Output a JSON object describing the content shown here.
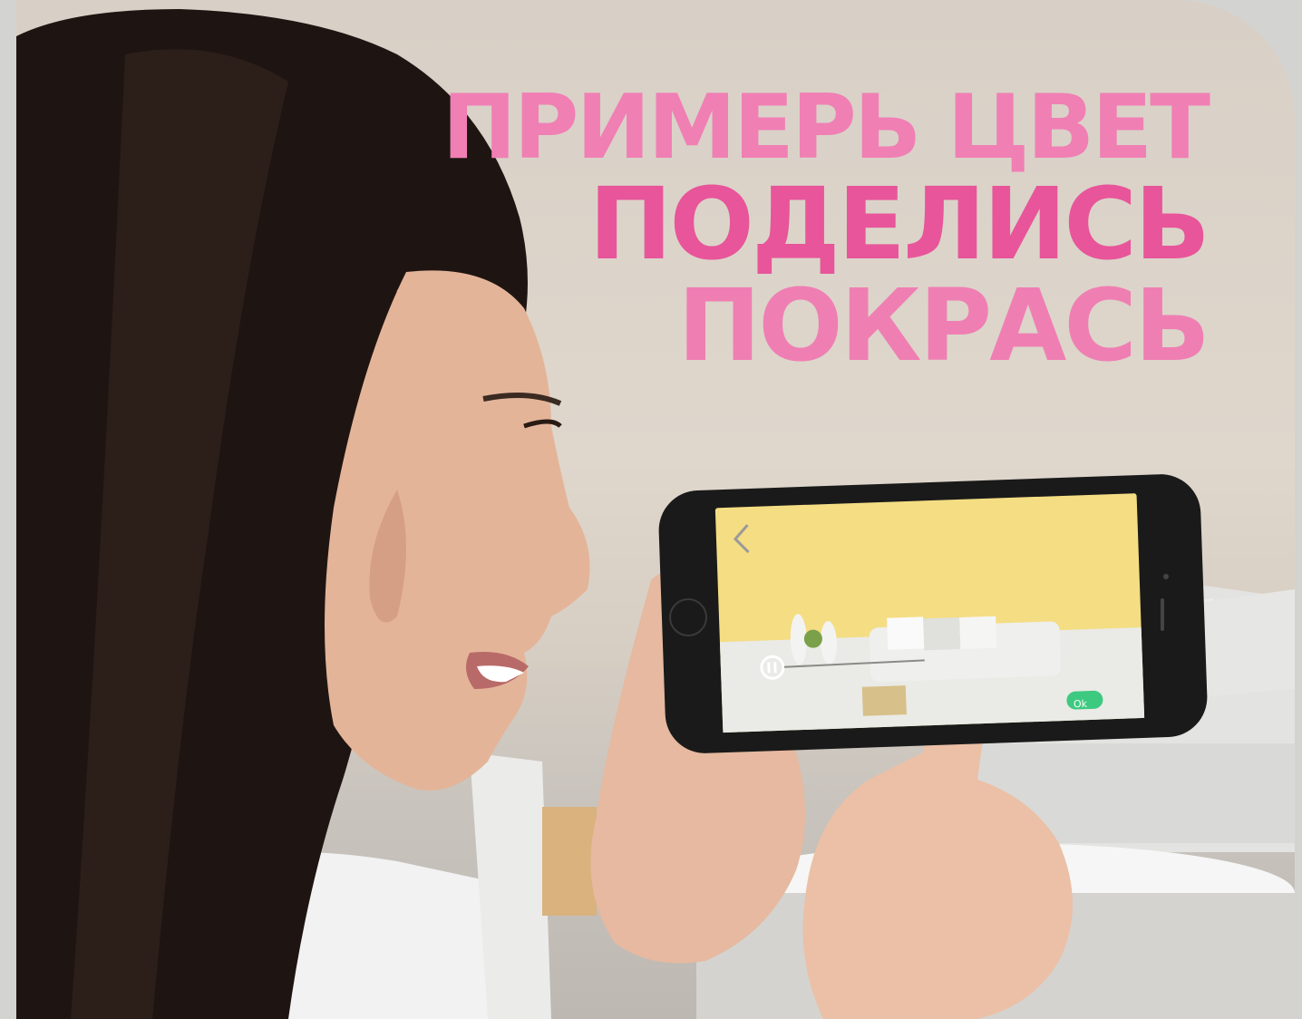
{
  "headline": {
    "line1": "ПРИМЕРЬ ЦВЕТ",
    "line2": "ПОДЕЛИСЬ",
    "line3": "ПОКРАСЬ"
  },
  "phone_screen": {
    "ok_button": "Ok",
    "back_icon": "chevron-left-icon",
    "wall_color": "#f4dd83",
    "swatch_color": "#d7c089",
    "ok_color": "#3ec980"
  },
  "colors": {
    "headline_light": "#f07fb4",
    "headline_dark": "#e8559a"
  }
}
